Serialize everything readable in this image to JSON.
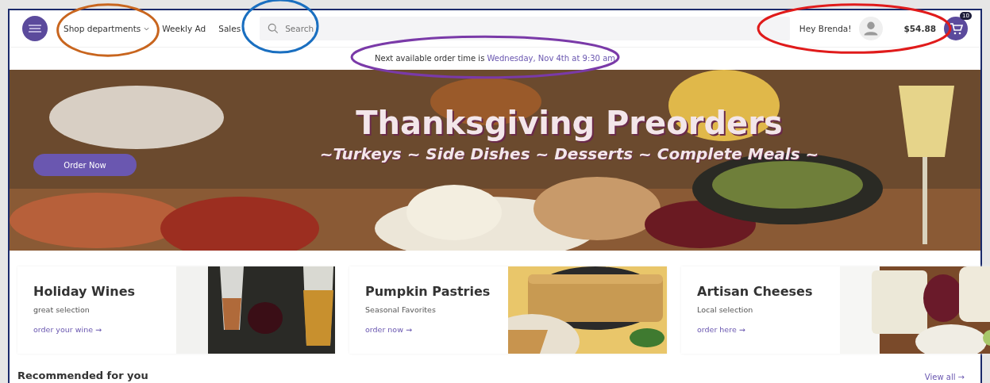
{
  "header": {
    "nav": [
      {
        "label": "Shop departments",
        "dropdown": true
      },
      {
        "label": "Weekly Ad",
        "dropdown": false
      },
      {
        "label": "Sales",
        "dropdown": false
      }
    ],
    "search": {
      "placeholder": "Search"
    },
    "greeting": "Hey Brenda!",
    "cart_total": "$54.88",
    "cart_count": "10"
  },
  "notice": {
    "text": "Next available order time is ",
    "highlight": "Wednesday, Nov 4th at 9:30 am"
  },
  "hero": {
    "title": "Thanksgiving Preorders",
    "subtitle": "~Turkeys ~ Side Dishes ~ Desserts ~ Complete Meals ~",
    "button": "Order Now"
  },
  "promos": [
    {
      "kind": "wine",
      "title": "Holiday Wines",
      "subtitle": "great selection",
      "link": "order your wine →"
    },
    {
      "kind": "pastry",
      "title": "Pumpkin Pastries",
      "subtitle": "Seasonal Favorites",
      "link": "order now →"
    },
    {
      "kind": "cheese",
      "title": "Artisan Cheeses",
      "subtitle": "Local selection",
      "link": "order here →"
    }
  ],
  "recommended": {
    "title": "Recommended for you",
    "link": "View all →"
  },
  "annotations": [
    {
      "color": "#c8651e"
    },
    {
      "color": "#1a6fc0"
    },
    {
      "color": "#7a3aa8"
    },
    {
      "color": "#e01b1b"
    }
  ]
}
